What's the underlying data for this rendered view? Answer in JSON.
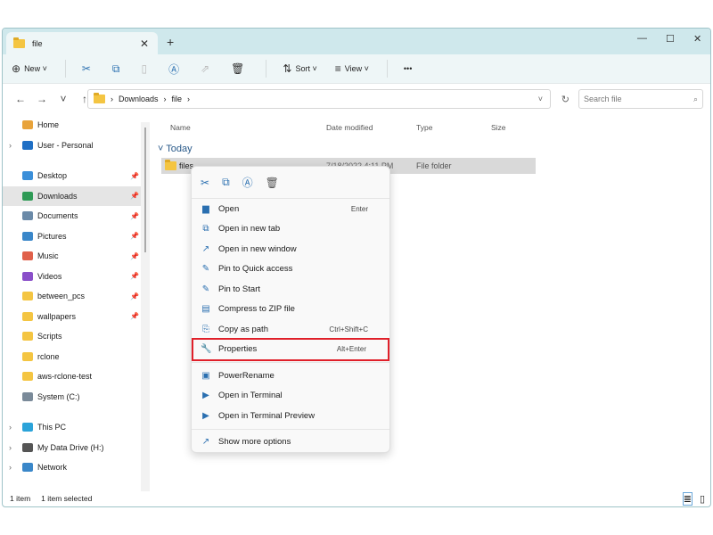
{
  "window": {
    "tab_title": "file",
    "new_tab": "+",
    "minimize": "—",
    "maximize": "☐",
    "close": "✕"
  },
  "toolbar": {
    "new_label": "New",
    "sort_label": "Sort",
    "view_label": "View",
    "more": "•••"
  },
  "address": {
    "path": [
      "Downloads",
      "file"
    ],
    "search_placeholder": "Search file"
  },
  "sidebar": {
    "items": [
      {
        "label": "Home",
        "icon": "home-icon",
        "color": "#e8a33b"
      },
      {
        "label": "User - Personal",
        "icon": "cloud-icon",
        "color": "#1f6fc5",
        "chev": true
      },
      {
        "label": "",
        "gap": true
      },
      {
        "label": "Desktop",
        "icon": "desktop-icon",
        "color": "#3b8fd9",
        "pin": true
      },
      {
        "label": "Downloads",
        "icon": "download-icon",
        "color": "#2e9a55",
        "pin": true,
        "selected": true
      },
      {
        "label": "Documents",
        "icon": "documents-icon",
        "color": "#6b8aa8",
        "pin": true
      },
      {
        "label": "Pictures",
        "icon": "pictures-icon",
        "color": "#3a87c9",
        "pin": true
      },
      {
        "label": "Music",
        "icon": "music-icon",
        "color": "#e0604a",
        "pin": true
      },
      {
        "label": "Videos",
        "icon": "videos-icon",
        "color": "#8a4fc9",
        "pin": true
      },
      {
        "label": "between_pcs",
        "icon": "folder-icon",
        "color": "#f4c542",
        "pin": true
      },
      {
        "label": "wallpapers",
        "icon": "folder-icon",
        "color": "#f4c542",
        "pin": true
      },
      {
        "label": "Scripts",
        "icon": "folder-icon",
        "color": "#f4c542"
      },
      {
        "label": "rclone",
        "icon": "folder-icon",
        "color": "#f4c542"
      },
      {
        "label": "aws-rclone-test",
        "icon": "folder-icon",
        "color": "#f4c542"
      },
      {
        "label": "System (C:)",
        "icon": "drive-icon",
        "color": "#7a8a99"
      },
      {
        "label": "",
        "gap": true
      },
      {
        "label": "This PC",
        "icon": "pc-icon",
        "color": "#2ba3d9",
        "chev": true
      },
      {
        "label": "My Data Drive (H:)",
        "icon": "drive-icon",
        "color": "#555",
        "chev": true
      },
      {
        "label": "Network",
        "icon": "network-icon",
        "color": "#3a87c9",
        "chev": true
      }
    ]
  },
  "columns": {
    "name": "Name",
    "date": "Date modified",
    "type": "Type",
    "size": "Size"
  },
  "group": "Today",
  "file": {
    "name": "files",
    "date": "7/18/2022 4:11 PM",
    "type": "File folder"
  },
  "context_menu": {
    "items": [
      {
        "label": "Open",
        "shortcut": "Enter",
        "icon": "folder-open-icon",
        "glyph": "▆"
      },
      {
        "label": "Open in new tab",
        "icon": "new-tab-icon",
        "glyph": "⧉"
      },
      {
        "label": "Open in new window",
        "icon": "new-window-icon",
        "glyph": "↗"
      },
      {
        "label": "Pin to Quick access",
        "icon": "pin-icon",
        "glyph": "✎"
      },
      {
        "label": "Pin to Start",
        "icon": "pin-start-icon",
        "glyph": "✎"
      },
      {
        "label": "Compress to ZIP file",
        "icon": "zip-icon",
        "glyph": "▤"
      },
      {
        "label": "Copy as path",
        "shortcut": "Ctrl+Shift+C",
        "icon": "copy-path-icon",
        "glyph": "⎘"
      },
      {
        "label": "Properties",
        "shortcut": "Alt+Enter",
        "icon": "wrench-icon",
        "glyph": "🔧",
        "highlight": true
      },
      {
        "sep": true
      },
      {
        "label": "PowerRename",
        "icon": "power-rename-icon",
        "glyph": "▣"
      },
      {
        "label": "Open in Terminal",
        "icon": "terminal-icon",
        "glyph": "▶"
      },
      {
        "label": "Open in Terminal Preview",
        "icon": "terminal-preview-icon",
        "glyph": "▶"
      },
      {
        "sep": true
      },
      {
        "label": "Show more options",
        "icon": "more-options-icon",
        "glyph": "↗"
      }
    ]
  },
  "status": {
    "count": "1 item",
    "selected": "1 item selected"
  },
  "colors": {
    "titlebar": "#cfe8ec",
    "highlight_outline": "#e0202a",
    "accent": "#2a6fb0"
  }
}
